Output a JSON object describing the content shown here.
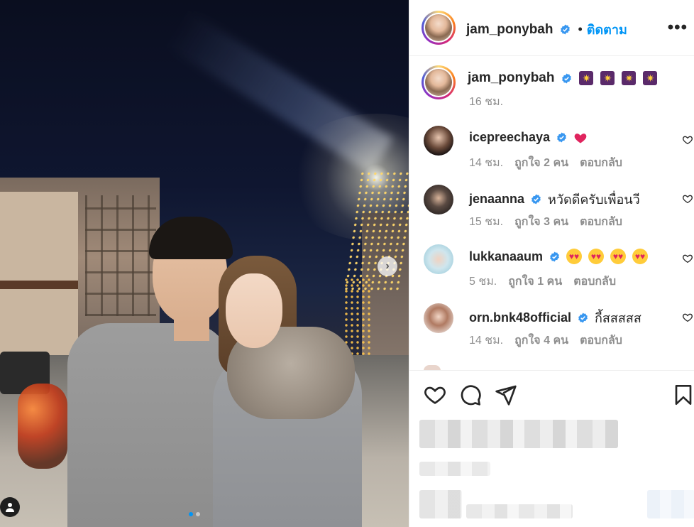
{
  "post": {
    "author": "jam_ponybah",
    "follow_label": "ติดตาม",
    "bullet": "•",
    "more_label": "•••",
    "caption_emoji": [
      "✷",
      "✷",
      "✷",
      "✷"
    ],
    "caption_time": "16 ชม."
  },
  "comments": [
    {
      "user": "icepreechaya",
      "text": "",
      "emoji": "heart",
      "time": "14 ชม.",
      "likes": "ถูกใจ 2 คน",
      "reply": "ตอบกลับ"
    },
    {
      "user": "jenaanna",
      "text": "หวัดดีครับเพื่อนวี",
      "emoji": "",
      "time": "15 ชม.",
      "likes": "ถูกใจ 3 คน",
      "reply": "ตอบกลับ"
    },
    {
      "user": "lukkanaaum",
      "text": "",
      "emoji": "heart-eyes",
      "time": "5 ชม.",
      "likes": "ถูกใจ 1 คน",
      "reply": "ตอบกลับ"
    },
    {
      "user": "orn.bnk48official",
      "text": "กี้สสสสส",
      "emoji": "",
      "time": "14 ชม.",
      "likes": "ถูกใจ 4 คน",
      "reply": "ตอบกลับ"
    }
  ],
  "photo": {
    "next_label": "›",
    "carousel_count": 2,
    "carousel_active": 1
  },
  "colors": {
    "accent": "#0095f6",
    "secondary_text": "#8e8e8e",
    "heart_red": "#ed4956"
  },
  "icons": [
    "verified-badge-icon",
    "heart-icon",
    "comment-icon",
    "share-icon",
    "bookmark-icon",
    "more-icon",
    "person-tag-icon",
    "chevron-right-icon"
  ]
}
